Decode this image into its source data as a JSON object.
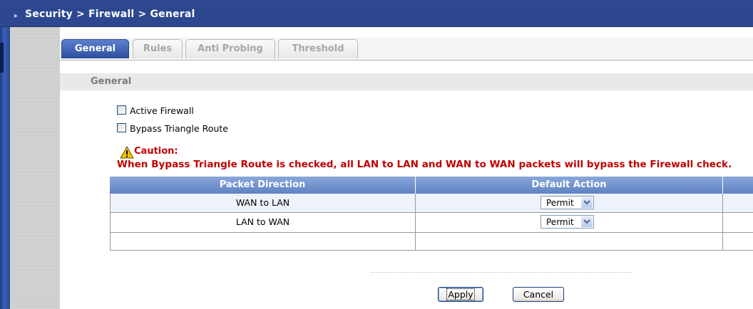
{
  "header": {
    "breadcrumb": "Security > Firewall > General"
  },
  "tabs": [
    {
      "label": "General",
      "active": true
    },
    {
      "label": "Rules",
      "active": false
    },
    {
      "label": "Anti Probing",
      "active": false
    },
    {
      "label": "Threshold",
      "active": false
    }
  ],
  "section": {
    "title": "General"
  },
  "options": {
    "active_firewall": {
      "label": "Active Firewall",
      "checked": false
    },
    "bypass_triangle_route": {
      "label": "Bypass Triangle Route",
      "checked": false
    }
  },
  "caution": {
    "title": "Caution:",
    "message": "When Bypass Triangle Route is checked, all LAN to LAN and WAN to WAN packets will bypass the Firewall check."
  },
  "policy_table": {
    "columns": [
      "Packet Direction",
      "Default Action"
    ],
    "rows": [
      {
        "direction": "WAN to LAN",
        "action": "Permit"
      },
      {
        "direction": "LAN to WAN",
        "action": "Permit"
      }
    ]
  },
  "buttons": {
    "apply": "Apply",
    "cancel": "Cancel"
  },
  "colors": {
    "title_bar": "#283f84",
    "active_tab": "#2e4f9f",
    "table_header": "#6f8fcc",
    "caution_text": "#c00000",
    "row_alt": "#eef2fa"
  },
  "icons": {
    "caution": "warning-triangle-icon",
    "breadcrumb": "breadcrumb-arrow-icon",
    "dropdown": "chevron-down-icon"
  }
}
